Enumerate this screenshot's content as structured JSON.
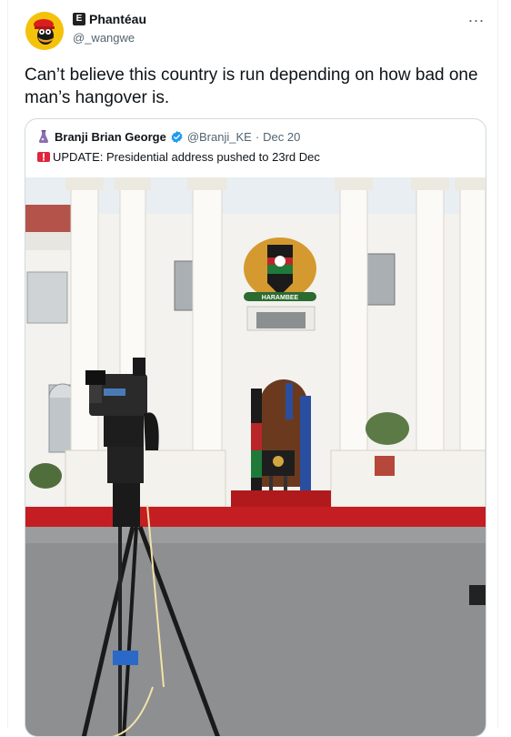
{
  "tweet": {
    "author": {
      "display_name": "Phantéau",
      "handle": "@_wangwe",
      "badge": "E"
    },
    "text": "Can’t believe this country is run depending on how bad one man’s hangover is.",
    "more_icon": "..."
  },
  "quote": {
    "author": {
      "display_name": "Branji Brian George",
      "handle": "@Branji_KE",
      "separator": "·",
      "date": "Dec 20"
    },
    "text": "UPDATE: Presidential address pushed to 23rd Dec",
    "photo_sign": "HARAMBEE"
  },
  "colors": {
    "verified": "#1d9bf0",
    "red_carpet": "#c41e22",
    "avatar_bg": "#f5c20b"
  }
}
